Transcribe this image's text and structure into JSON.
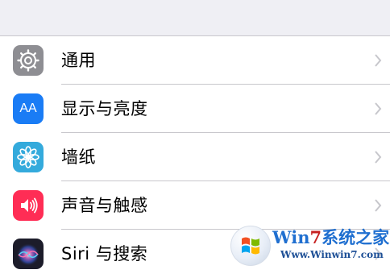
{
  "settings": {
    "items": [
      {
        "label": "通用",
        "icon": "gear-icon",
        "icon_color": "#8e8e93"
      },
      {
        "label": "显示与亮度",
        "icon": "display-brightness-icon",
        "icon_color": "#1a7cf5"
      },
      {
        "label": "墙纸",
        "icon": "wallpaper-flower-icon",
        "icon_color": "#34aadc"
      },
      {
        "label": "声音与触感",
        "icon": "speaker-icon",
        "icon_color": "#ff2d55"
      },
      {
        "label": "Siri 与搜索",
        "icon": "siri-icon",
        "icon_color": "#2a2a3a"
      }
    ],
    "display_icon_text": "AA"
  },
  "watermark": {
    "title_part1": "Win",
    "title_part2": "7",
    "title_part3": "系统之家",
    "url": "Www.Winwin7.com"
  }
}
